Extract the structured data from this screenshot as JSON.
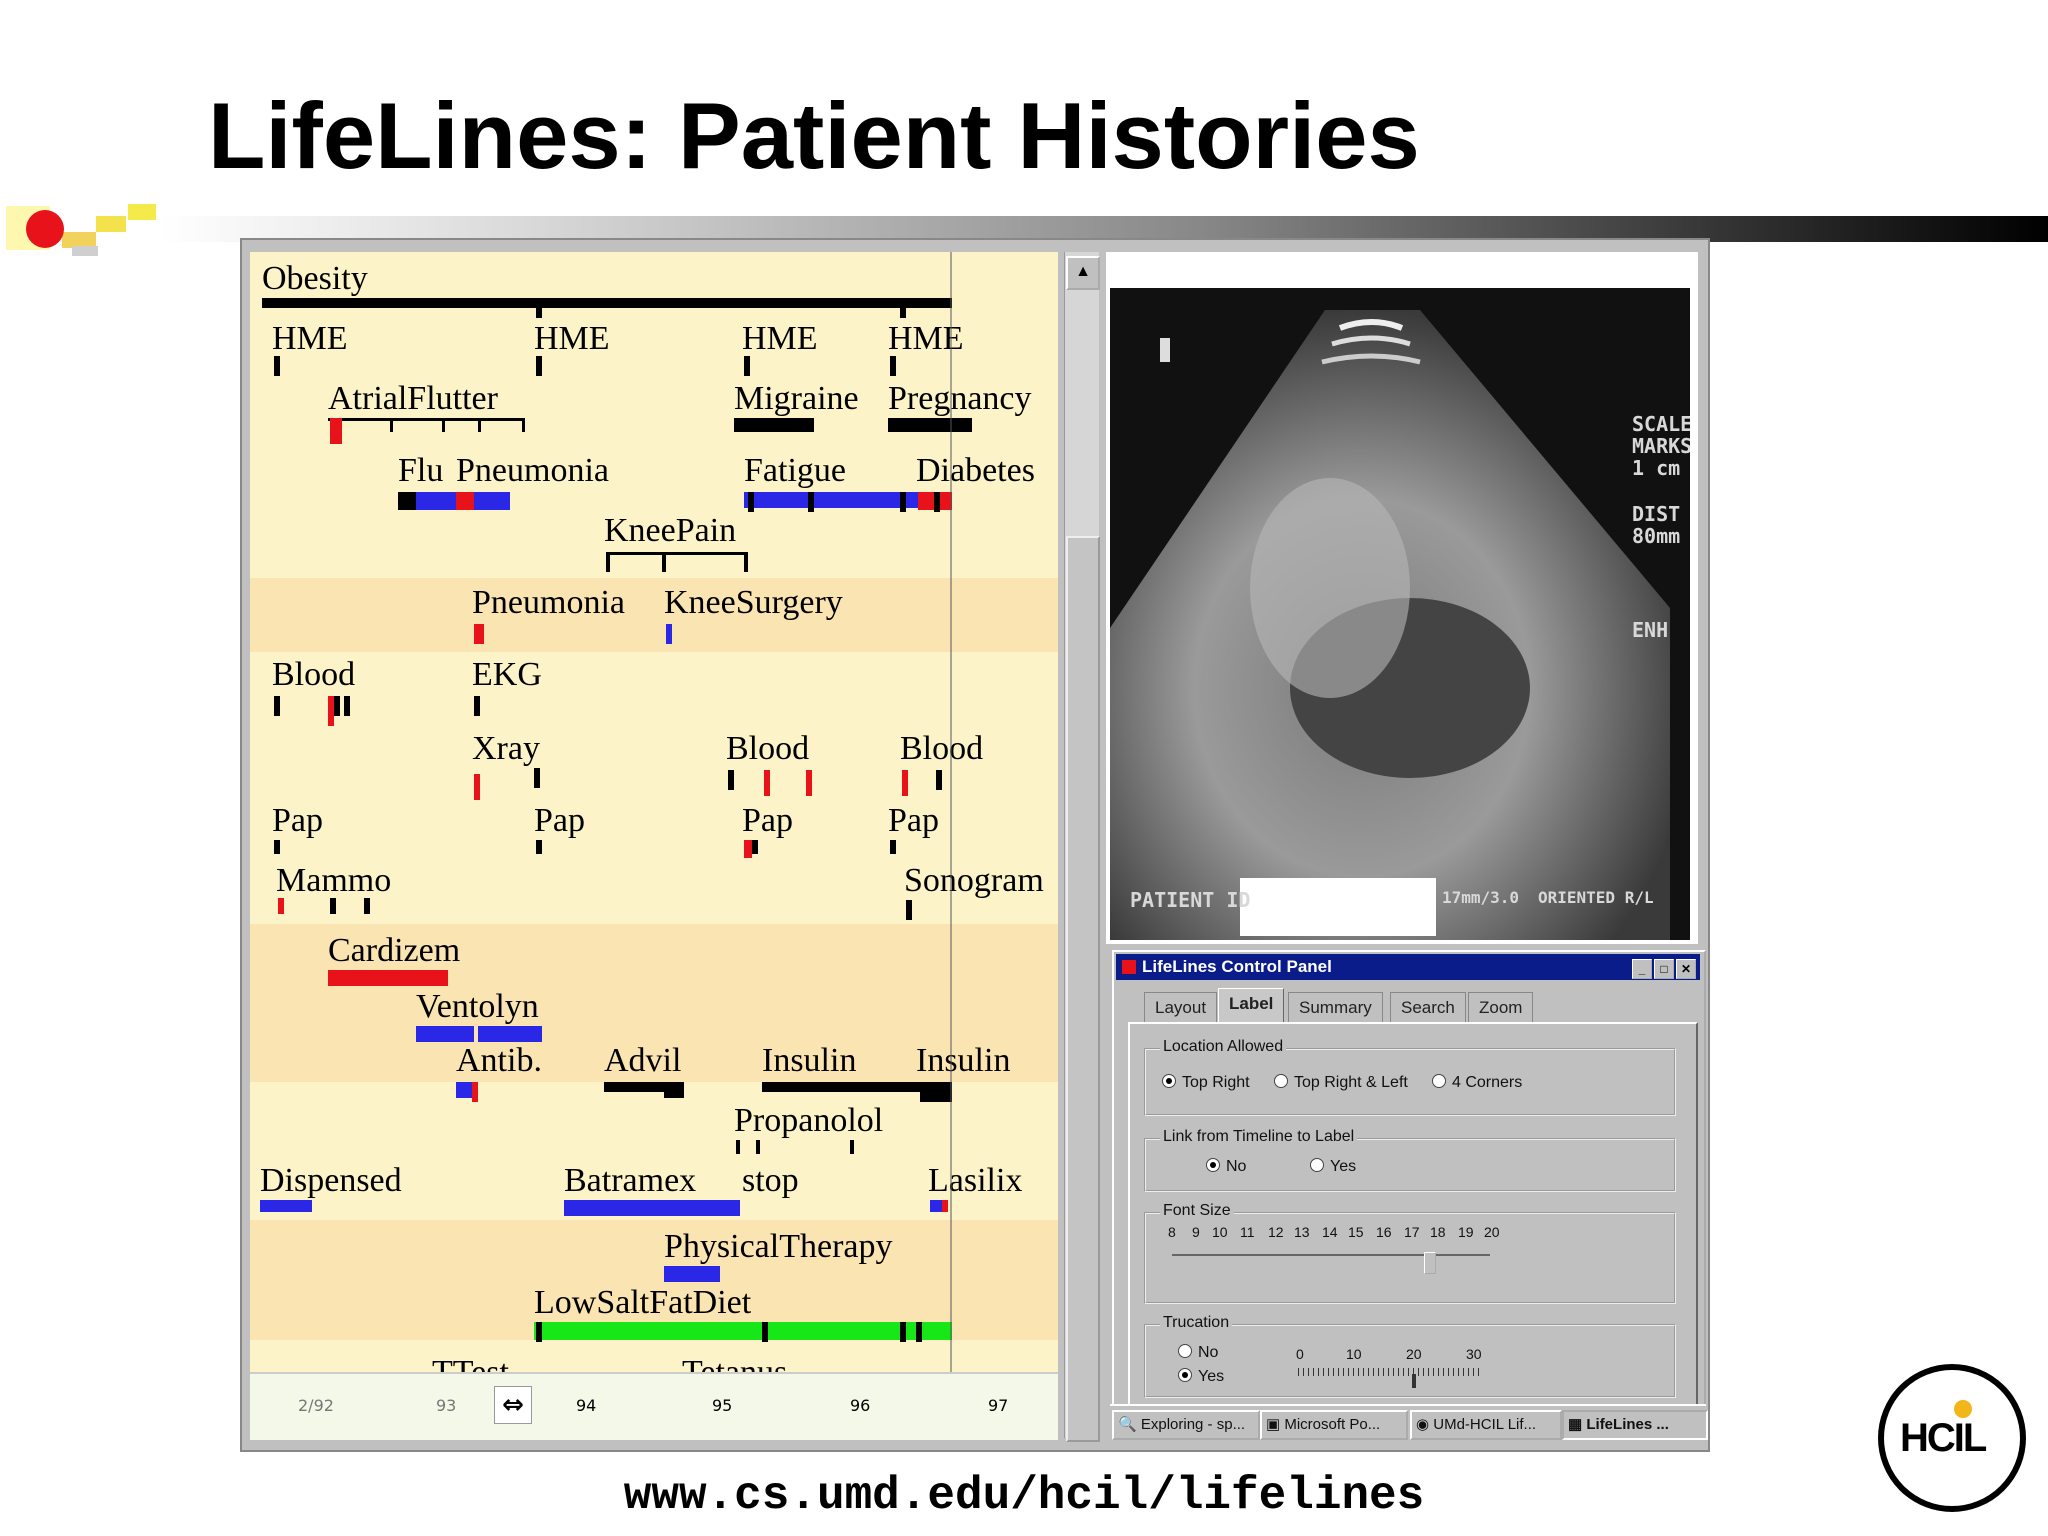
{
  "slide": {
    "title": "LifeLines: Patient Histories",
    "url": "www.cs.umd.edu/hcil/lifelines",
    "logo": "HCIL"
  },
  "colors": {
    "timeline_bg": "#fcf3c8",
    "band_bg": "#fae4b2",
    "black": "#000000",
    "red": "#e8131a",
    "blue": "#2a28e6",
    "green": "#17e617",
    "titlebar": "#0a1b8a"
  },
  "timeline": {
    "labels": {
      "obesity": "Obesity",
      "hme1": "HME",
      "hme2": "HME",
      "hme3": "HME",
      "hme4": "HME",
      "atrialflutter": "AtrialFlutter",
      "migraine": "Migraine",
      "pregnancy": "Pregnancy",
      "flu": "Flu",
      "pneumonia1": "Pneumonia",
      "fatigue": "Fatigue",
      "diabetes": "Diabetes",
      "kneepain": "KneePain",
      "pneumonia2": "Pneumonia",
      "kneesurgery": "KneeSurgery",
      "blood1": "Blood",
      "ekg": "EKG",
      "xray": "Xray",
      "blood2": "Blood",
      "blood3": "Blood",
      "pap1": "Pap",
      "pap2": "Pap",
      "pap3": "Pap",
      "pap4": "Pap",
      "mammo": "Mammo",
      "sonogram": "Sonogram",
      "cardizem": "Cardizem",
      "ventolyn": "Ventolyn",
      "antib": "Antib.",
      "advil": "Advil",
      "insulin1": "Insulin",
      "insulin2": "Insulin",
      "propanolol": "Propanolol",
      "dispensed": "Dispensed",
      "batramex": "Batramex",
      "stop": "stop",
      "lasilix": "Lasilix",
      "physicaltherapy": "PhysicalTherapy",
      "lowsaltfatdiet": "LowSaltFatDiet",
      "ttest": "TTest",
      "tetanus": "Tetanus"
    },
    "axis": {
      "labels": [
        "2/92",
        "93",
        "94",
        "95",
        "96",
        "97"
      ],
      "pan_icon": "pan-arrows-icon"
    }
  },
  "sonogram": {
    "labels": {
      "scale": "SCALE",
      "marks": "MARKS",
      "cm": "1 cm",
      "dist": "DIST",
      "dist_val": "80mm",
      "enh": "ENH",
      "patient_id": "PATIENT ID",
      "mode": "17mm/3.0",
      "oriented": "ORIENTED R/L"
    }
  },
  "control_panel": {
    "title": "LifeLines Control Panel",
    "tabs": [
      "Layout",
      "Label",
      "Summary",
      "Search",
      "Zoom"
    ],
    "active_tab": "Label",
    "location": {
      "label": "Location Allowed",
      "options": [
        "Top Right",
        "Top Right & Left",
        "4 Corners"
      ],
      "selected": "Top Right"
    },
    "link": {
      "label": "Link from Timeline to Label",
      "options": [
        "No",
        "Yes"
      ],
      "selected": "No"
    },
    "font_size": {
      "label": "Font Size",
      "ticks": [
        "8",
        "9",
        "10",
        "11",
        "12",
        "13",
        "14",
        "15",
        "16",
        "17",
        "18",
        "19",
        "20"
      ],
      "value": 18
    },
    "truncation": {
      "label": "Trucation",
      "options": [
        "No",
        "Yes"
      ],
      "selected": "Yes",
      "ticks": [
        "0",
        "10",
        "20",
        "30"
      ],
      "value": 20
    }
  },
  "taskbar": {
    "items": [
      "Exploring - sp...",
      "Microsoft Po...",
      "UMd-HCIL Lif...",
      "LifeLines ..."
    ]
  }
}
